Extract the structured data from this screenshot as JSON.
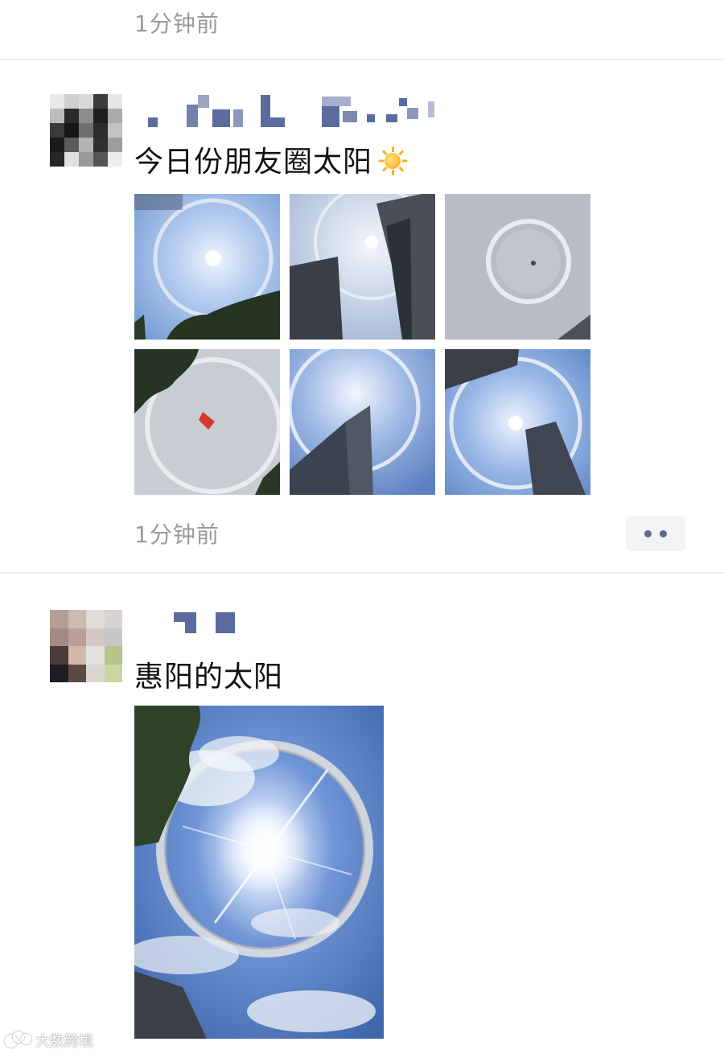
{
  "feed": {
    "top_timestamp": "1分钟前",
    "posts": [
      {
        "text": "今日份朋友圈太阳",
        "emoji": "sun-icon",
        "timestamp": "1分钟前",
        "photo_count": 6
      },
      {
        "text": "惠阳的太阳",
        "photo_count": 1
      }
    ]
  },
  "watermark": {
    "text": "大数跨境"
  },
  "colors": {
    "timestamp": "#9a9a9a",
    "username_pixel": "#5b6b9e",
    "divider": "#ececec",
    "more_button_bg": "#f3f4f6"
  }
}
